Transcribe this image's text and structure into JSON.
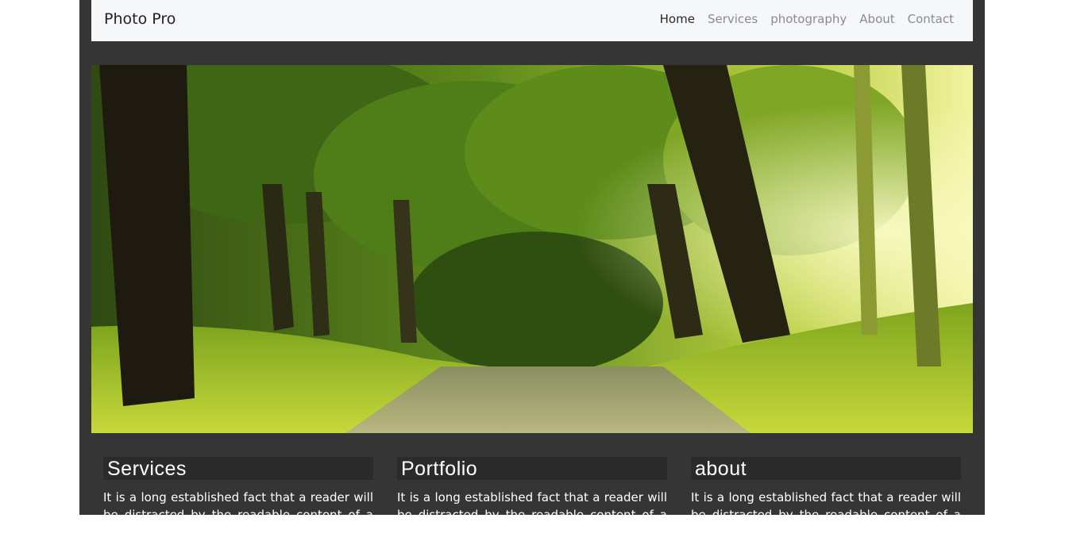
{
  "navbar": {
    "brand": "Photo Pro",
    "links": [
      "Home",
      "Services",
      "photography",
      "About",
      "Contact"
    ],
    "active_link": "Home"
  },
  "hero": {
    "image_description_icon": "forest-road-photo"
  },
  "sections": [
    {
      "heading": "Services",
      "text": "It is a long established fact that a reader will be distracted by the readable content of a page"
    },
    {
      "heading": "Portfolio",
      "text": "It is a long established fact that a reader will be distracted by the readable content of a page"
    },
    {
      "heading": "about",
      "text": "It is a long established fact that a reader will be distracted by the readable content of a page"
    }
  ],
  "colors": {
    "page_background": "#353535",
    "navbar_background": "#f6f7f9",
    "heading_background": "#2b2b2b",
    "text": "#ffffff"
  }
}
